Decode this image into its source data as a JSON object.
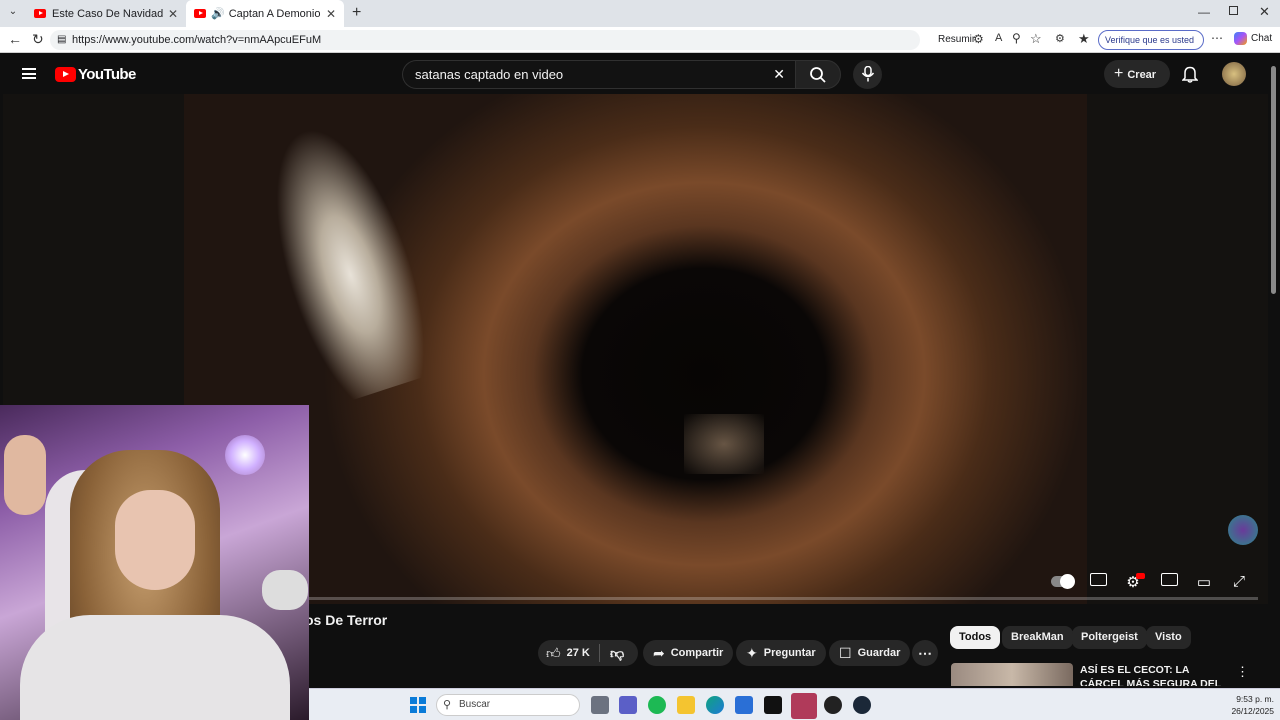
{
  "browser": {
    "tabs": [
      {
        "title": "Este Caso De Navidad Es Perturbad",
        "active": false
      },
      {
        "title": "Captan A Demonio Real En Cá",
        "active": true
      }
    ],
    "url": "https://www.youtube.com/watch?v=nmAApcuEFuM",
    "summarize_label": "Resumir",
    "verify_label": "Verifique que es usted",
    "chat_label": "Chat"
  },
  "youtube": {
    "logo_text": "YouTube",
    "search_query": "satanas captado en video",
    "create_label": "Crear",
    "video_title": "os De Terror",
    "actions": {
      "likes": "27 K",
      "share": "Compartir",
      "ask": "Preguntar",
      "save": "Guardar"
    },
    "chips": [
      "Todos",
      "BreakMan",
      "Poltergeist",
      "Visto"
    ],
    "recommendation": {
      "title": "ASÍ ES EL CECOT: LA CÁRCEL MÁS SEGURA DEL MUNDO"
    },
    "colors": {
      "accent": "#ff0000",
      "background": "#0f0f0f"
    }
  },
  "taskbar": {
    "search_placeholder": "Buscar",
    "time": "9:53 p. m.",
    "date": "26/12/2025"
  }
}
